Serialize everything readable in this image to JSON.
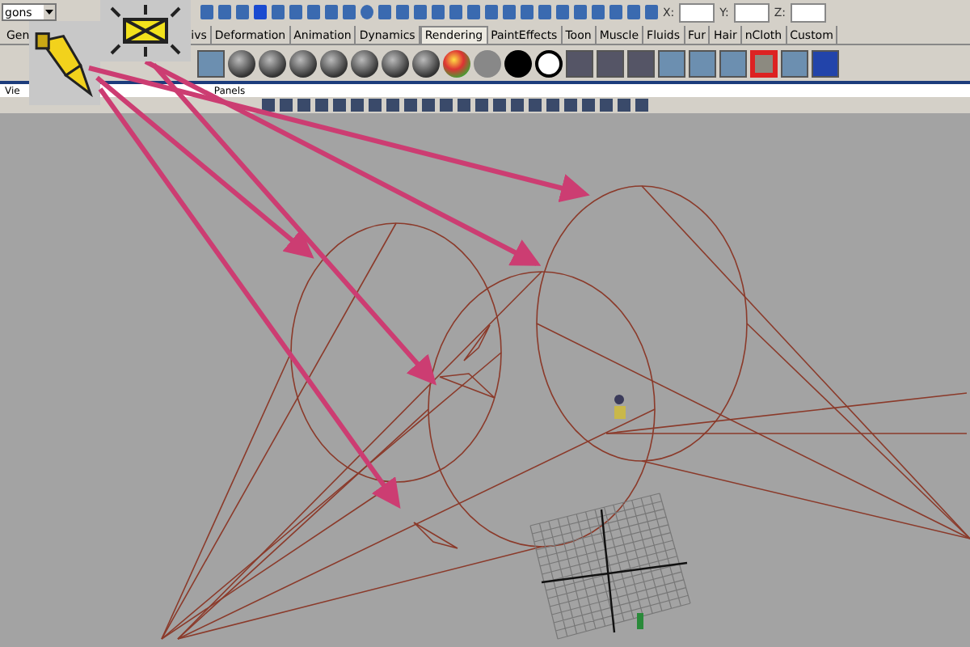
{
  "status_line": {
    "mode_field": "gons",
    "coords": [
      {
        "label": "X:"
      },
      {
        "label": "Y:"
      },
      {
        "label": "Z:"
      }
    ]
  },
  "shelf_tabs": [
    {
      "label": "Gen",
      "selected": false
    },
    {
      "label": "ivs",
      "selected": false
    },
    {
      "label": "Deformation",
      "selected": false
    },
    {
      "label": "Animation",
      "selected": false
    },
    {
      "label": "Dynamics",
      "selected": false
    },
    {
      "label": "Rendering",
      "selected": true
    },
    {
      "label": "PaintEffects",
      "selected": false
    },
    {
      "label": "Toon",
      "selected": false
    },
    {
      "label": "Muscle",
      "selected": false
    },
    {
      "label": "Fluids",
      "selected": false
    },
    {
      "label": "Fur",
      "selected": false
    },
    {
      "label": "Hair",
      "selected": false
    },
    {
      "label": "nCloth",
      "selected": false
    },
    {
      "label": "Custom",
      "selected": false
    }
  ],
  "panel_menu": [
    "Vie",
    "Panels"
  ]
}
